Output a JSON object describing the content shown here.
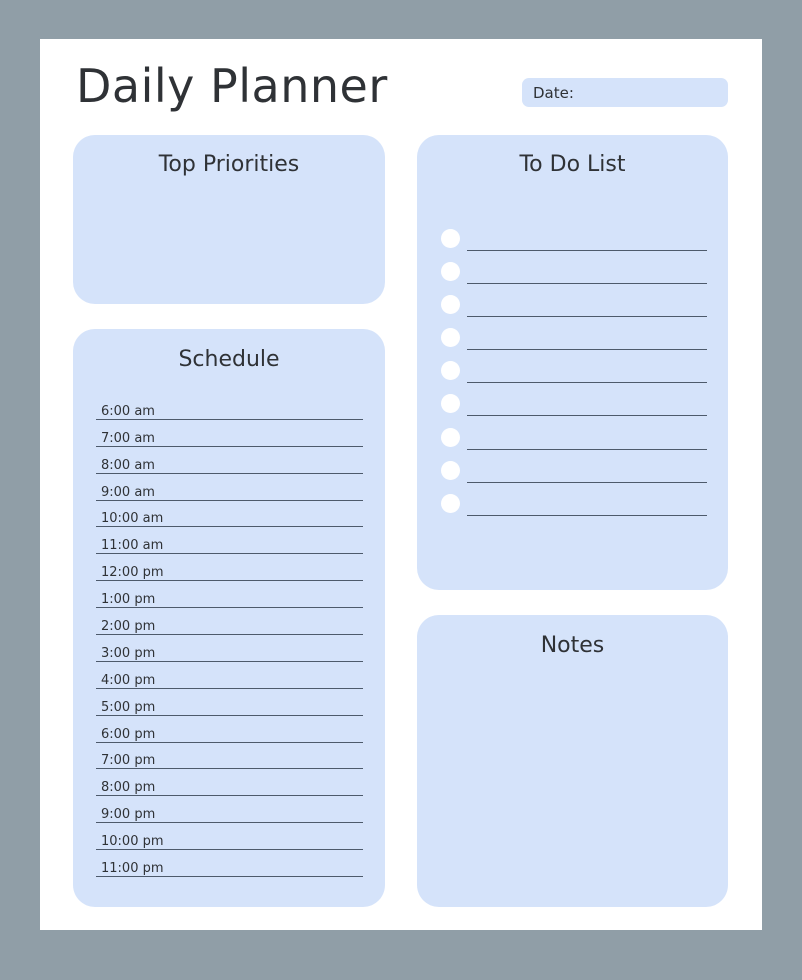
{
  "title": "Daily Planner",
  "date_label": "Date:",
  "sections": {
    "top_priorities": "Top Priorities",
    "to_do_list": "To Do List",
    "schedule": "Schedule",
    "notes": "Notes"
  },
  "schedule_slots": [
    "6:00 am",
    "7:00 am",
    "8:00 am",
    "9:00 am",
    "10:00 am",
    "11:00 am",
    "12:00 pm",
    "1:00 pm",
    "2:00 pm",
    "3:00 pm",
    "4:00 pm",
    "5:00 pm",
    "6:00 pm",
    "7:00 pm",
    "8:00 pm",
    "9:00 pm",
    "10:00 pm",
    "11:00 pm"
  ],
  "todo_item_count": 9,
  "colors": {
    "background": "#909ea7",
    "page": "#ffffff",
    "card": "#d5e3fa",
    "text": "#2f3236",
    "rule": "#4d5a6b"
  }
}
